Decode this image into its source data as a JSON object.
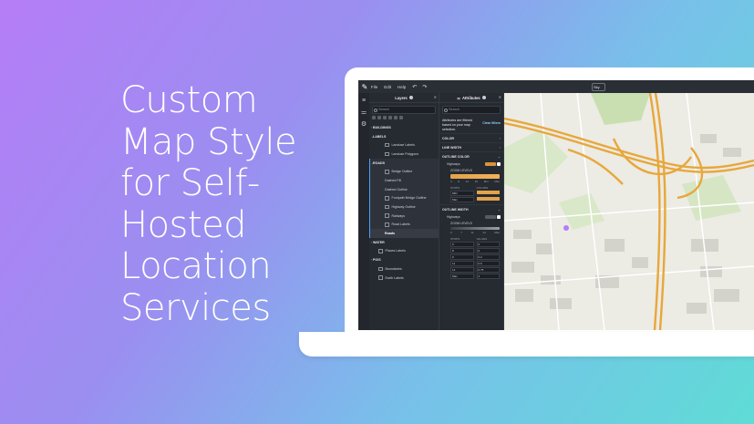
{
  "headline": {
    "lines": [
      "Custom",
      "Map Style",
      "for Self-",
      "Hosted",
      "Location",
      "Services"
    ]
  },
  "menubar": {
    "items": [
      "File",
      "Edit",
      "Help"
    ],
    "undo_icon": "undo-icon",
    "redo_icon": "redo-icon",
    "style_selector": "Sky"
  },
  "layers_panel": {
    "title": "Layers",
    "search_placeholder": "Search",
    "rows": [
      {
        "label": "BUILDINGS",
        "level": "sec"
      },
      {
        "label": "LABELS",
        "level": "sec"
      },
      {
        "label": "Landuse Labels",
        "level": "i2"
      },
      {
        "label": "Landuse Polygons",
        "level": "i2"
      },
      {
        "label": "ROADS",
        "level": "sec-hl"
      },
      {
        "label": "Bridge Outline",
        "level": "i2"
      },
      {
        "label": "Dashed Fill",
        "level": "i2"
      },
      {
        "label": "Dashed Outline",
        "level": "i2"
      },
      {
        "label": "Footpath Bridge Outline",
        "level": "i2"
      },
      {
        "label": "Highway Outline",
        "level": "i2"
      },
      {
        "label": "Railways",
        "level": "i2"
      },
      {
        "label": "Road Labels",
        "level": "i2"
      },
      {
        "label": "Roads",
        "level": "i2-hl"
      },
      {
        "label": "WATER",
        "level": "sec"
      },
      {
        "label": "Places Labels",
        "level": "i1"
      },
      {
        "label": "POIS",
        "level": "sec"
      },
      {
        "label": "Boundaries",
        "level": "i1"
      },
      {
        "label": "Earth Labels",
        "level": "i1"
      }
    ]
  },
  "attributes_panel": {
    "title": "Attributes",
    "search_placeholder": "Search",
    "info_text": "Attributes are filtered based on your map selection.",
    "clear_filters": "Clear filters",
    "sections": {
      "color": "COLOR",
      "line_width": "LINE WIDTH",
      "outline_color": "OUTLINE COLOR",
      "outline_width": "OUTLINE WIDTH"
    },
    "outline_color": {
      "row_label": "Highways",
      "zoom_levels_label": "ZOOM LEVELS",
      "ticks": [
        "4",
        "8",
        "12",
        "16",
        "Min",
        "Max"
      ],
      "stops_header": "STOPS",
      "colors_header": "COLORS",
      "stops": [
        "MIN",
        "Max"
      ],
      "swatch_color": "#d8943a"
    },
    "outline_width": {
      "row_label": "Highways",
      "zoom_levels_label": "ZOOM LEVELS",
      "ticks": [
        "0",
        "7",
        "11",
        "14",
        "Max"
      ],
      "stops_header": "STOPS",
      "values_header": "VALUES",
      "stops": [
        "0",
        "8",
        "9",
        "11",
        "14",
        "Max"
      ],
      "values": [
        "0",
        "0",
        "0.2",
        "0.6",
        "0.75",
        "2"
      ]
    }
  },
  "colors": {
    "accent_highway": "#e8a73a",
    "map_bg": "#ecebe4",
    "park": "#c9dfb2"
  }
}
